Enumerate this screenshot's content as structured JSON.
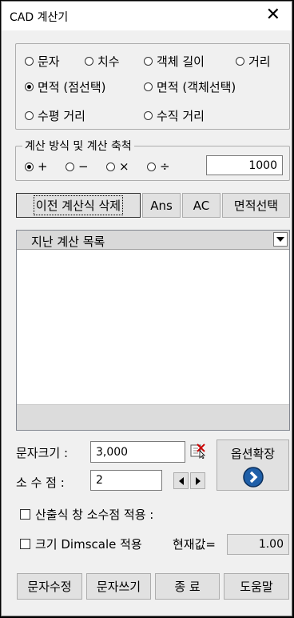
{
  "window": {
    "title": "CAD 계산기",
    "close_glyph": "✕"
  },
  "mode": {
    "options": [
      "문자",
      "치수",
      "객체 길이",
      "거리",
      "면적 (점선택)",
      "면적 (객체선택)",
      "수평 거리",
      "수직 거리"
    ],
    "selected": "면적 (점선택)"
  },
  "calc": {
    "legend": "계산 방식 및 계산 축척",
    "ops": [
      "+",
      "−",
      "×",
      "÷"
    ],
    "selected": "+",
    "scale": "1000"
  },
  "buttons": {
    "delete_prev": "이전 계산식 삭제",
    "ans": "Ans",
    "ac": "AC",
    "area_select": "면적선택"
  },
  "history": {
    "header": "지난 계산 목록"
  },
  "text_size": {
    "label": "문자크기 :",
    "value": "3,000"
  },
  "decimal": {
    "label": "소 수 점 :",
    "value": "2"
  },
  "option_expand": {
    "label": "옵션확장"
  },
  "checks": {
    "apply_decimal": "산출식 창 소수점 적용 :",
    "dimscale": "크기 Dimscale 적용",
    "current_label": "현재값=",
    "current_value": "1.00"
  },
  "footer": {
    "edit_text": "문자수정",
    "write_text": "문자쓰기",
    "exit": "종 료",
    "help": "도움말"
  }
}
